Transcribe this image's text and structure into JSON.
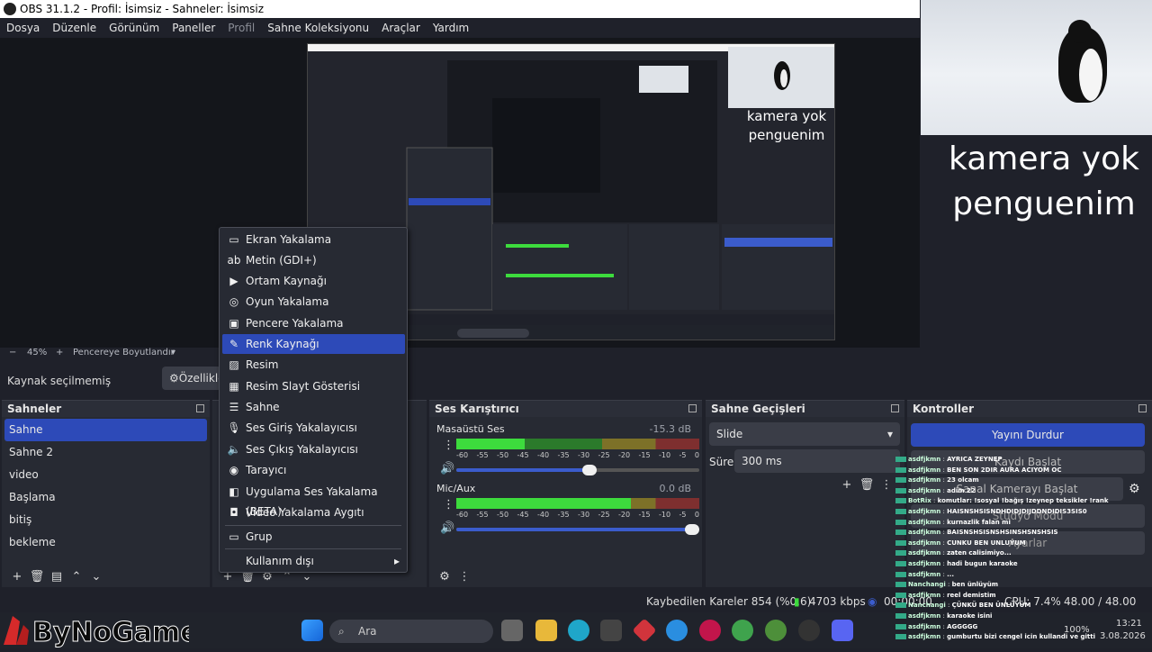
{
  "window": {
    "title": "OBS 31.1.2 - Profil: İsimsiz - Sahneler: İsimsiz"
  },
  "menu": [
    "Dosya",
    "Düzenle",
    "Görünüm",
    "Paneller",
    "Profil",
    "Sahne Koleksiyonu",
    "Araçlar",
    "Yardım"
  ],
  "webcam": {
    "overlay_text_line1": "kamera yok",
    "overlay_text_line2": "penguenim"
  },
  "zoom": {
    "minus": "−",
    "value": "45%",
    "plus": "+",
    "mode": "Pencereye Boyutlandır"
  },
  "source_bar": {
    "no_source": "Kaynak seçilmemiş",
    "properties": "Özellikle"
  },
  "scenes": {
    "title": "Sahneler",
    "items": [
      "Sahne",
      "Sahne 2",
      "video",
      "Başlama",
      "bitiş",
      "bekleme"
    ],
    "selected_index": 0
  },
  "context_menu": {
    "items": [
      {
        "label": "Ekran Yakalama",
        "icon": "monitor-icon"
      },
      {
        "label": "Metin (GDI+)",
        "icon": "text-icon"
      },
      {
        "label": "Ortam Kaynağı",
        "icon": "play-icon"
      },
      {
        "label": "Oyun Yakalama",
        "icon": "gamepad-icon"
      },
      {
        "label": "Pencere Yakalama",
        "icon": "window-icon"
      },
      {
        "label": "Renk Kaynağı",
        "icon": "brush-icon"
      },
      {
        "label": "Resim",
        "icon": "image-icon"
      },
      {
        "label": "Resim Slayt Gösterisi",
        "icon": "slideshow-icon"
      },
      {
        "label": "Sahne",
        "icon": "list-icon"
      },
      {
        "label": "Ses Giriş Yakalayıcısı",
        "icon": "microphone-icon"
      },
      {
        "label": "Ses Çıkış Yakalayıcısı",
        "icon": "speaker-icon"
      },
      {
        "label": "Tarayıcı",
        "icon": "globe-icon"
      },
      {
        "label": "Uygulama Ses Yakalama (BETA)",
        "icon": "app-audio-icon"
      },
      {
        "label": "Video Yakalama Aygıtı",
        "icon": "camera-icon"
      },
      {
        "label": "Grup",
        "icon": "folder-icon"
      },
      {
        "label": "Kullanım dışı",
        "icon": "submenu-arrow-icon"
      }
    ],
    "highlighted_index": 5
  },
  "mixer": {
    "title": "Ses Karıştırıcı",
    "tracks": [
      {
        "name": "Masaüstü Ses",
        "db": "-15.3 dB",
        "level_fraction": 0.28,
        "volume_fraction": 0.55
      },
      {
        "name": "Mic/Aux",
        "db": "0.0 dB",
        "level_fraction": 0.72,
        "volume_fraction": 1.0
      }
    ],
    "ticks": [
      "-60",
      "-55",
      "-50",
      "-45",
      "-40",
      "-35",
      "-30",
      "-25",
      "-20",
      "-15",
      "-10",
      "-5",
      "0"
    ]
  },
  "transitions": {
    "title": "Sahne Geçişleri",
    "selected": "Slide",
    "duration_label": "Süre",
    "duration_value": "300 ms"
  },
  "controls": {
    "title": "Kontroller",
    "stream": "Yayını Durdur",
    "record": "Kaydı Başlat",
    "virtual_cam": "Sanal Kamerayı Başlat",
    "studio": "Stüdyo Modu",
    "settings": "Ayarlar"
  },
  "status": {
    "dropped": "Kaybedilen Kareler 854 (%0.6)",
    "bitrate": "4703 kbps",
    "time": "00:00:00",
    "cpu": "CPU: 7.4%",
    "fps": "48.00 / 48.00 FPS"
  },
  "taskbar": {
    "search": "Ara",
    "battery": "100%",
    "time": "13:21",
    "date": "3.08.2026"
  },
  "watermark": "ByNoGame",
  "chat": [
    {
      "user": "asdfjkmn",
      "msg": "AYRICA ZEYNEP"
    },
    {
      "user": "asdfjkmn",
      "msg": "BEN SON 2DIR AURA ACIYOM OC"
    },
    {
      "user": "asdfjkmn",
      "msg": "23 olcam"
    },
    {
      "user": "asdfjkmn",
      "msg": "adim 22"
    },
    {
      "user": "BotRix",
      "msg": "komutlar: !sosyal !bağış !zeynep teksikler !rank"
    },
    {
      "user": "asdfjkmn",
      "msg": "HAISNSHSISNDHDIDJDIJDDNDIDIS3SIS0"
    },
    {
      "user": "asdfjkmn",
      "msg": "kurnazlik falan mi"
    },
    {
      "user": "asdfjkmn",
      "msg": "BAISNSHSISNSHSINSHSNSHSIS"
    },
    {
      "user": "asdfjkmn",
      "msg": "CUNKU BEN UNLUYUM"
    },
    {
      "user": "asdfjkmn",
      "msg": "zaten calisimiyo..."
    },
    {
      "user": "asdfjkmn",
      "msg": "hadi bugun karaoke"
    },
    {
      "user": "asdfjkmn",
      "msg": "..."
    },
    {
      "user": "Nanchangi",
      "msg": "ben ünlüyüm"
    },
    {
      "user": "asdfjkmn",
      "msg": "reel demistim"
    },
    {
      "user": "Nanchangi",
      "msg": "ÇÜNKÜ BEN ÜNLÜYÜM"
    },
    {
      "user": "asdfjkmn",
      "msg": "karaoke isini"
    },
    {
      "user": "asdfjkmn",
      "msg": "AGGGGG"
    },
    {
      "user": "asdfjkmn",
      "msg": "gumburtu bizi cengel icin kullandi ve gitti"
    }
  ]
}
